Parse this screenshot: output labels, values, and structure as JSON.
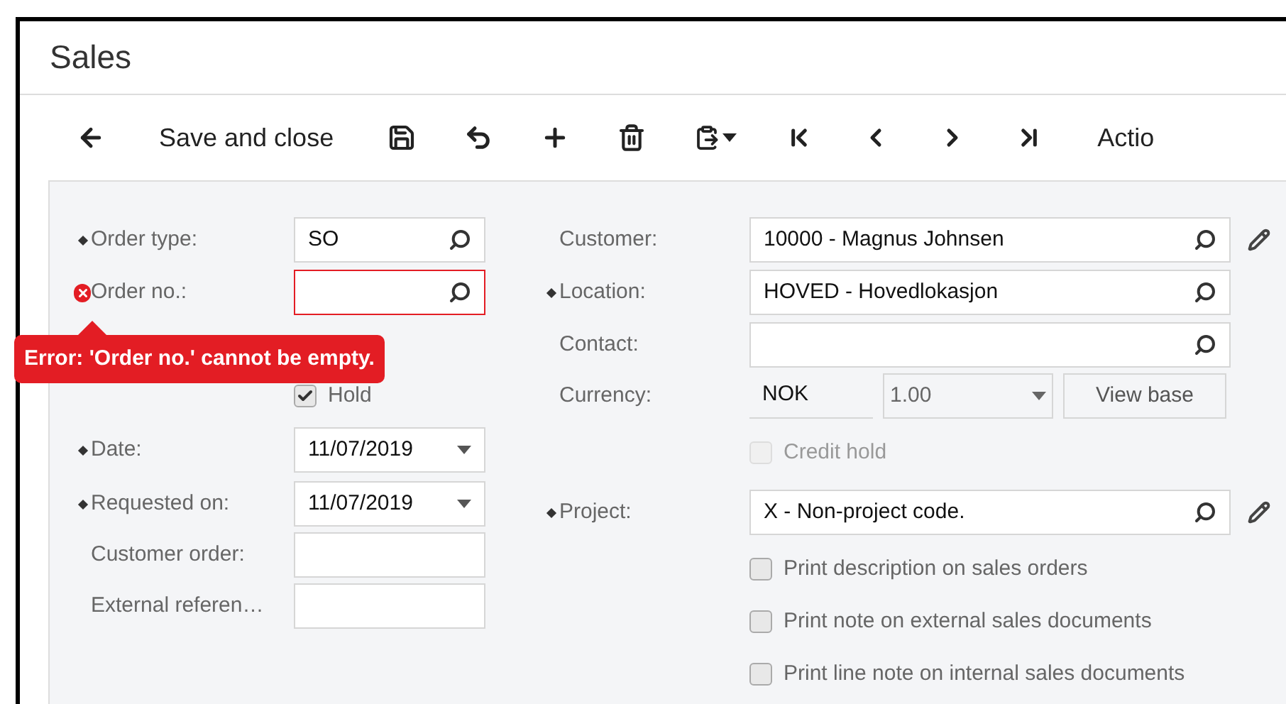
{
  "window": {
    "title": "Sales"
  },
  "toolbar": [
    {
      "kind": "back"
    },
    {
      "kind": "text",
      "label": "Save and close"
    },
    {
      "kind": "save"
    },
    {
      "kind": "undo"
    },
    {
      "kind": "add"
    },
    {
      "kind": "delete"
    },
    {
      "kind": "paste"
    },
    {
      "kind": "first"
    },
    {
      "kind": "prev"
    },
    {
      "kind": "next"
    },
    {
      "kind": "last"
    },
    {
      "kind": "text",
      "label": "Actio"
    }
  ],
  "left_fields": [
    {
      "kind": "lookup",
      "label": "Order type:",
      "required": true,
      "error": false,
      "value": "SO"
    },
    {
      "kind": "lookup",
      "label": "Order no.:",
      "required": false,
      "error": true
    },
    {
      "kind": "checkbox",
      "label": "Hold",
      "checked": true,
      "disabled": false
    },
    {
      "kind": "date",
      "label": "Date:",
      "required": true,
      "value": "11/07/2019"
    },
    {
      "kind": "date",
      "label": "Requested on:",
      "required": true,
      "value": "11/07/2019"
    },
    {
      "kind": "text",
      "label": "Customer order:",
      "required": false
    },
    {
      "kind": "text",
      "label": "External referen…",
      "required": false
    }
  ],
  "right_fields": [
    {
      "kind": "lookup",
      "label": "Customer:",
      "required": false,
      "value": "10000 - Magnus Johnsen",
      "editable": true
    },
    {
      "kind": "lookup",
      "label": "Location:",
      "required": true,
      "value": "HOVED - Hovedlokasjon",
      "editable": false
    },
    {
      "kind": "lookup",
      "label": "Contact:",
      "required": false,
      "editable": false
    },
    {
      "kind": "currency",
      "label": "Currency:",
      "value": "NOK",
      "rate": "1.00",
      "button": "View base"
    },
    {
      "kind": "checkbox",
      "label": "Credit hold",
      "checked": false,
      "disabled": true
    },
    {
      "kind": "lookup",
      "label": "Project:",
      "required": true,
      "value": "X - Non-project code.",
      "editable": true
    },
    {
      "kind": "checkbox",
      "label": "Print description on sales orders",
      "checked": false,
      "disabled": false
    },
    {
      "kind": "checkbox",
      "label": "Print note on external sales documents",
      "checked": false,
      "disabled": false
    },
    {
      "kind": "checkbox",
      "label": "Print line note on internal sales documents",
      "checked": false,
      "disabled": false
    }
  ],
  "error_tooltip": {
    "text": "Error: 'Order no.' cannot be empty."
  }
}
